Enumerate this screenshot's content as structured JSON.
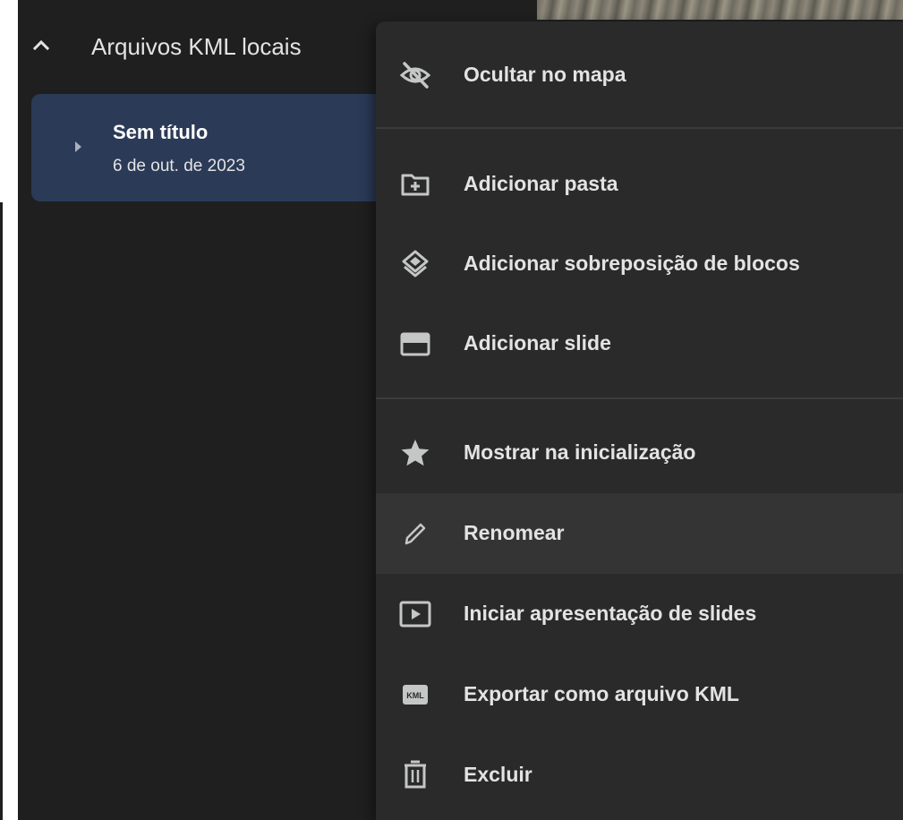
{
  "sidebar": {
    "section_title": "Arquivos KML locais",
    "project": {
      "title": "Sem título",
      "date": "6 de out. de 2023"
    }
  },
  "context_menu": {
    "items": [
      {
        "label": "Ocultar no mapa",
        "icon": "visibility-off-icon"
      },
      {
        "label": "Adicionar pasta",
        "icon": "add-folder-icon"
      },
      {
        "label": "Adicionar sobreposição de blocos",
        "icon": "tile-overlay-icon"
      },
      {
        "label": "Adicionar slide",
        "icon": "slide-icon"
      },
      {
        "label": "Mostrar na inicialização",
        "icon": "star-icon"
      },
      {
        "label": "Renomear",
        "icon": "pencil-icon"
      },
      {
        "label": "Iniciar apresentação de slides",
        "icon": "play-slideshow-icon"
      },
      {
        "label": "Exportar como arquivo KML",
        "icon": "kml-file-icon"
      },
      {
        "label": "Excluir",
        "icon": "trash-icon"
      }
    ],
    "hovered_item": "Renomear"
  },
  "colors": {
    "panel_background": "#1f1f1f",
    "menu_background": "#2a2a2a",
    "selected_card": "#2b3a57",
    "hover_row": "#343434",
    "text": "#e3e3e3"
  }
}
